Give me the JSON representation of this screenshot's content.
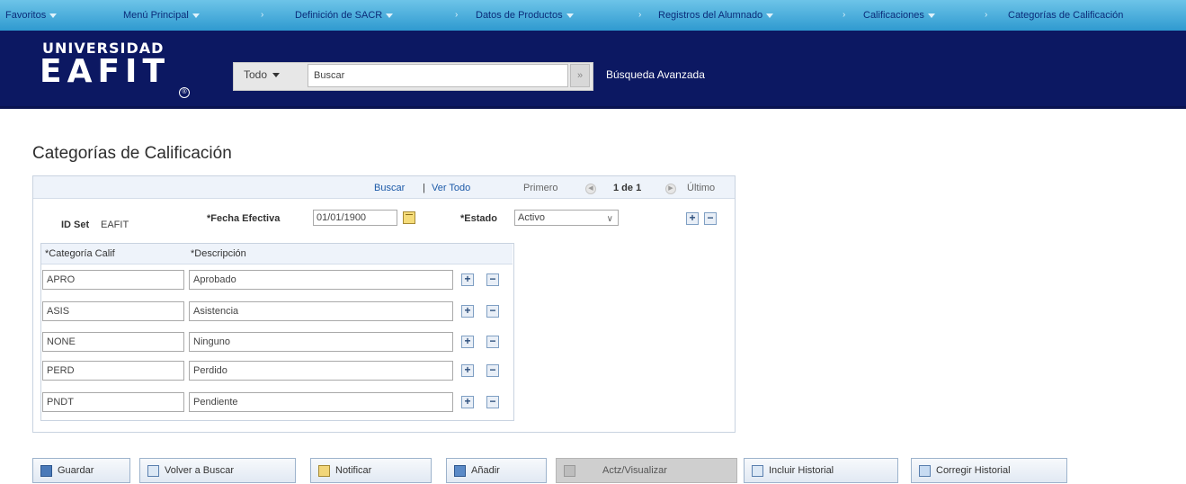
{
  "topnav": {
    "items": [
      "Favoritos",
      "Menú Principal",
      "Definición de SACR",
      "Datos de Productos",
      "Registros del Alumnado",
      "Calificaciones",
      "Categorías de Calificación"
    ]
  },
  "header": {
    "logo_line1": "UNIVERSIDAD",
    "logo_line2": "EAFIT",
    "logo_mark": "®",
    "search_scope": "Todo",
    "search_placeholder": "Buscar",
    "go_glyph": "»",
    "advanced_search": "Búsqueda Avanzada"
  },
  "page": {
    "title": "Categorías de Calificación"
  },
  "form": {
    "nav": {
      "buscar": "Buscar",
      "sep": "|",
      "ver_todo": "Ver Todo",
      "primero": "Primero",
      "count": "1 de 1",
      "ultimo": "Último"
    },
    "idset_label": "ID Set",
    "idset_value": "EAFIT",
    "fecha_label": "*Fecha Efectiva",
    "fecha_value": "01/01/1900",
    "estado_label": "*Estado",
    "estado_value": "Activo",
    "grid": {
      "col1": "*Categoría Calif",
      "col2": "*Descripción",
      "rows": [
        {
          "code": "APRO",
          "desc": "Aprobado"
        },
        {
          "code": "ASIS",
          "desc": "Asistencia"
        },
        {
          "code": "NONE",
          "desc": "Ninguno"
        },
        {
          "code": "PERD",
          "desc": "Perdido"
        },
        {
          "code": "PNDT",
          "desc": "Pendiente"
        }
      ]
    }
  },
  "toolbar": {
    "guardar": "Guardar",
    "volver": "Volver a Buscar",
    "notificar": "Notificar",
    "anadir": "Añadir",
    "actualizar": "Actz/Visualizar",
    "incluir": "Incluir Historial",
    "corregir": "Corregir Historial"
  }
}
